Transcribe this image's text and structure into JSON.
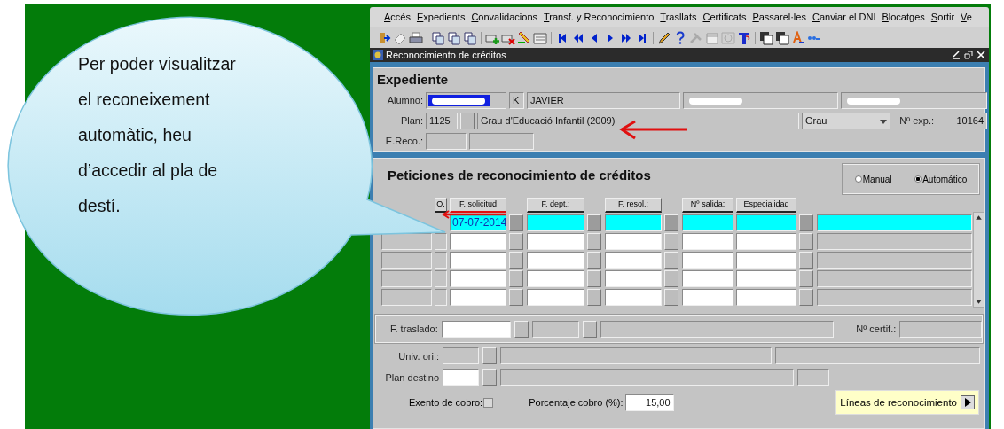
{
  "callout": {
    "text": "Per poder visualitzar\nel reconeixement\nautomàtic, heu\nd’accedir al pla de\ndestí."
  },
  "menu": [
    "Accés",
    "Expedients",
    "Convalidacions",
    "Transf. y Reconocimiento",
    "Trasllats",
    "Certificats",
    "Passarel·les",
    "Canviar el DNI",
    "Blocatges",
    "Sortir",
    "Ve"
  ],
  "window": {
    "title": "Reconocimiento de créditos"
  },
  "expediente": {
    "title": "Expediente",
    "alumno_label": "Alumno:",
    "initial": "K",
    "first_name": "JAVIER",
    "plan_label": "Plan:",
    "plan_code": "1125",
    "plan_name": "Grau d'Educació Infantil (2009)",
    "plan_type": "Grau",
    "exp_label": "Nº exp.:",
    "exp": "10164",
    "reco_label": "E.Reco.:"
  },
  "peticiones": {
    "title": "Peticiones de reconocimiento de créditos",
    "modes": [
      {
        "label": "Manual",
        "selected": false
      },
      {
        "label": "Automático",
        "selected": true
      }
    ],
    "columns": [
      "O.",
      "F. solicitud",
      "F. dept.:",
      "F. resol.:",
      "Nº salida:",
      "Especialidad"
    ],
    "rows": [
      {
        "f_solicitud": "07-07-2014",
        "current": true
      },
      {
        "current": false
      },
      {
        "current": false
      },
      {
        "current": false
      },
      {
        "current": false
      }
    ]
  },
  "traslado": {
    "label": "F. traslado:",
    "certif_label": "Nº certif.:"
  },
  "univ": {
    "label": "Univ. ori.:"
  },
  "plan_destino": {
    "label": "Plan destino"
  },
  "exento": {
    "label": "Exento de cobro:",
    "checked": false
  },
  "porcentaje": {
    "label": "Porcentaje cobro (%):",
    "value": "15,00"
  },
  "lineas_button": "Líneas de reconocimiento"
}
